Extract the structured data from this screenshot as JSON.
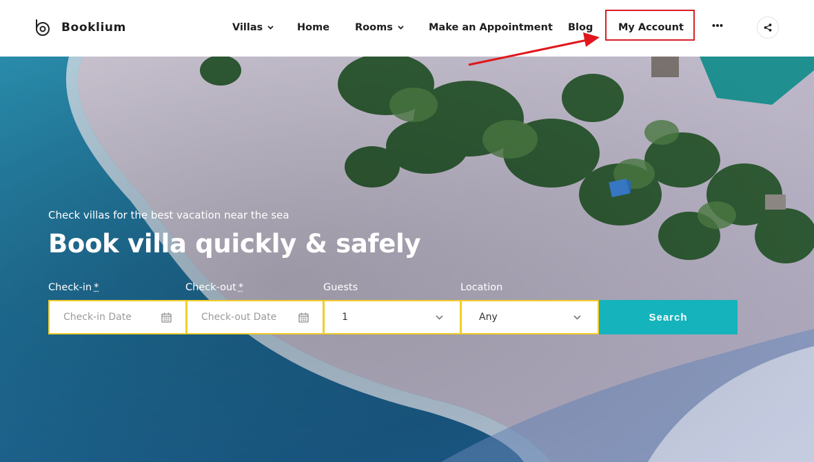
{
  "brand": {
    "name": "Booklium"
  },
  "nav": {
    "villas": "Villas",
    "home": "Home",
    "rooms": "Rooms",
    "appointment": "Make an Appointment",
    "blog": "Blog",
    "account": "My Account"
  },
  "icons": {
    "logo": "booklium-logo-icon",
    "more": "ellipsis-icon",
    "share": "share-icon",
    "calendar": "calendar-icon",
    "dropdown": "chevron-down-icon"
  },
  "hero": {
    "subtitle": "Check villas for the best vacation near the sea",
    "title": "Book villa quickly & safely"
  },
  "search_form": {
    "checkin_label": "Check-in",
    "checkout_label": "Check-out",
    "required_mark": "*",
    "guests_label": "Guests",
    "location_label": "Location",
    "checkin_placeholder": "Check-in Date",
    "checkout_placeholder": "Check-out Date",
    "guests_value": "1",
    "location_value": "Any",
    "search_button": "Search"
  },
  "colors": {
    "accent": "#15b3bc",
    "field_border": "#f2cd2a",
    "annotation": "#d81f26",
    "text_dark": "#1e1e1e"
  }
}
